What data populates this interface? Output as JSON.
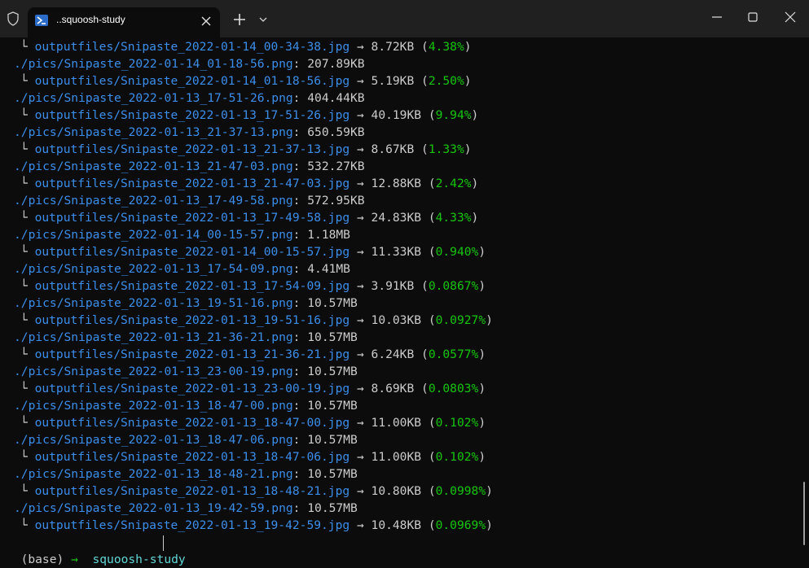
{
  "window": {
    "tab_title": "..squoosh-study",
    "tab_icon": "powershell-icon"
  },
  "terminal": {
    "lines": [
      {
        "kind": "out",
        "tree": "└ ",
        "path": "outputfiles/Snipaste_2022-01-14_00-34-38.jpg",
        "size": " → 8.72KB (",
        "pct": "4.38%",
        "close": ")"
      },
      {
        "kind": "src",
        "path": "./pics/Snipaste_2022-01-14_01-18-56.png",
        "size": ": 207.89KB"
      },
      {
        "kind": "out",
        "tree": "└ ",
        "path": "outputfiles/Snipaste_2022-01-14_01-18-56.jpg",
        "size": " → 5.19KB (",
        "pct": "2.50%",
        "close": ")"
      },
      {
        "kind": "src",
        "path": "./pics/Snipaste_2022-01-13_17-51-26.png",
        "size": ": 404.44KB"
      },
      {
        "kind": "out",
        "tree": "└ ",
        "path": "outputfiles/Snipaste_2022-01-13_17-51-26.jpg",
        "size": " → 40.19KB (",
        "pct": "9.94%",
        "close": ")"
      },
      {
        "kind": "src",
        "path": "./pics/Snipaste_2022-01-13_21-37-13.png",
        "size": ": 650.59KB"
      },
      {
        "kind": "out",
        "tree": "└ ",
        "path": "outputfiles/Snipaste_2022-01-13_21-37-13.jpg",
        "size": " → 8.67KB (",
        "pct": "1.33%",
        "close": ")"
      },
      {
        "kind": "src",
        "path": "./pics/Snipaste_2022-01-13_21-47-03.png",
        "size": ": 532.27KB"
      },
      {
        "kind": "out",
        "tree": "└ ",
        "path": "outputfiles/Snipaste_2022-01-13_21-47-03.jpg",
        "size": " → 12.88KB (",
        "pct": "2.42%",
        "close": ")"
      },
      {
        "kind": "src",
        "path": "./pics/Snipaste_2022-01-13_17-49-58.png",
        "size": ": 572.95KB"
      },
      {
        "kind": "out",
        "tree": "└ ",
        "path": "outputfiles/Snipaste_2022-01-13_17-49-58.jpg",
        "size": " → 24.83KB (",
        "pct": "4.33%",
        "close": ")"
      },
      {
        "kind": "src",
        "path": "./pics/Snipaste_2022-01-14_00-15-57.png",
        "size": ": 1.18MB"
      },
      {
        "kind": "out",
        "tree": "└ ",
        "path": "outputfiles/Snipaste_2022-01-14_00-15-57.jpg",
        "size": " → 11.33KB (",
        "pct": "0.940%",
        "close": ")"
      },
      {
        "kind": "src",
        "path": "./pics/Snipaste_2022-01-13_17-54-09.png",
        "size": ": 4.41MB"
      },
      {
        "kind": "out",
        "tree": "└ ",
        "path": "outputfiles/Snipaste_2022-01-13_17-54-09.jpg",
        "size": " → 3.91KB (",
        "pct": "0.0867%",
        "close": ")"
      },
      {
        "kind": "src",
        "path": "./pics/Snipaste_2022-01-13_19-51-16.png",
        "size": ": 10.57MB"
      },
      {
        "kind": "out",
        "tree": "└ ",
        "path": "outputfiles/Snipaste_2022-01-13_19-51-16.jpg",
        "size": " → 10.03KB (",
        "pct": "0.0927%",
        "close": ")"
      },
      {
        "kind": "src",
        "path": "./pics/Snipaste_2022-01-13_21-36-21.png",
        "size": ": 10.57MB"
      },
      {
        "kind": "out",
        "tree": "└ ",
        "path": "outputfiles/Snipaste_2022-01-13_21-36-21.jpg",
        "size": " → 6.24KB (",
        "pct": "0.0577%",
        "close": ")"
      },
      {
        "kind": "src",
        "path": "./pics/Snipaste_2022-01-13_23-00-19.png",
        "size": ": 10.57MB"
      },
      {
        "kind": "out",
        "tree": "└ ",
        "path": "outputfiles/Snipaste_2022-01-13_23-00-19.jpg",
        "size": " → 8.69KB (",
        "pct": "0.0803%",
        "close": ")"
      },
      {
        "kind": "src",
        "path": "./pics/Snipaste_2022-01-13_18-47-00.png",
        "size": ": 10.57MB"
      },
      {
        "kind": "out",
        "tree": "└ ",
        "path": "outputfiles/Snipaste_2022-01-13_18-47-00.jpg",
        "size": " → 11.00KB (",
        "pct": "0.102%",
        "close": ")"
      },
      {
        "kind": "src",
        "path": "./pics/Snipaste_2022-01-13_18-47-06.png",
        "size": ": 10.57MB"
      },
      {
        "kind": "out",
        "tree": "└ ",
        "path": "outputfiles/Snipaste_2022-01-13_18-47-06.jpg",
        "size": " → 11.00KB (",
        "pct": "0.102%",
        "close": ")"
      },
      {
        "kind": "src",
        "path": "./pics/Snipaste_2022-01-13_18-48-21.png",
        "size": ": 10.57MB"
      },
      {
        "kind": "out",
        "tree": "└ ",
        "path": "outputfiles/Snipaste_2022-01-13_18-48-21.jpg",
        "size": " → 10.80KB (",
        "pct": "0.0998%",
        "close": ")"
      },
      {
        "kind": "src",
        "path": "./pics/Snipaste_2022-01-13_19-42-59.png",
        "size": ": 10.57MB"
      },
      {
        "kind": "out",
        "tree": "└ ",
        "path": "outputfiles/Snipaste_2022-01-13_19-42-59.jpg",
        "size": " → 10.48KB (",
        "pct": "0.0969%",
        "close": ")"
      }
    ],
    "prompt": {
      "env": "(base)",
      "arrow": "→",
      "dir": "squoosh-study"
    }
  },
  "colors": {
    "background": "#0c0c0c",
    "titlebar": "#202020",
    "path_blue": "#3b8eea",
    "percent_green": "#16c60c",
    "prompt_cyan": "#61d6d6",
    "text": "#cccccc"
  }
}
